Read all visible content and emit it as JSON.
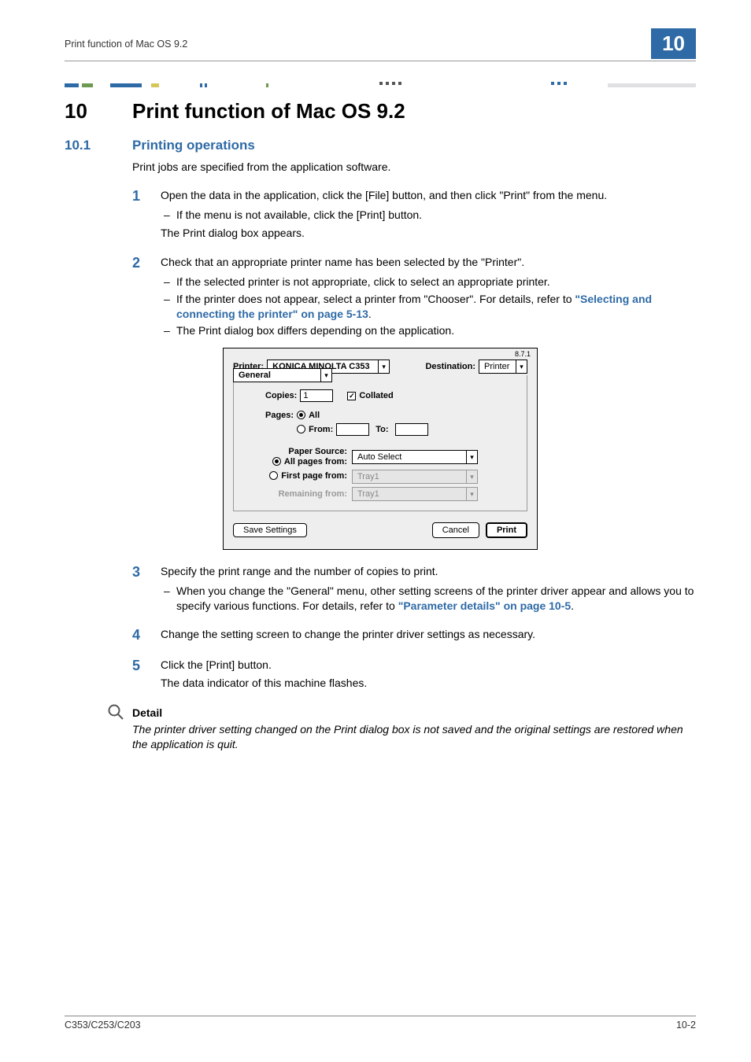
{
  "header": {
    "running_title": "Print function of Mac OS 9.2",
    "chapter_badge": "10"
  },
  "section": {
    "number": "10",
    "title": "Print function of Mac OS 9.2"
  },
  "subsection": {
    "number": "10.1",
    "title": "Printing operations"
  },
  "intro": "Print jobs are specified from the application software.",
  "steps": {
    "s1": {
      "num": "1",
      "text": "Open the data in the application, click the [File] button, and then click \"Print\" from the menu.",
      "bullet1": "If the menu is not available, click the [Print] button.",
      "plain1": "The Print dialog box appears."
    },
    "s2": {
      "num": "2",
      "text": "Check that an appropriate printer name has been selected by the \"Printer\".",
      "bullet1": "If the selected printer is not appropriate, click to select an appropriate printer.",
      "bullet2a": "If the printer does not appear, select a printer from \"Chooser\". For details, refer to ",
      "bullet2_link": "\"Selecting and connecting the printer\" on page 5-13",
      "bullet2b": ".",
      "bullet3": "The Print dialog box differs depending on the application."
    },
    "s3": {
      "num": "3",
      "text": "Specify the print range and the number of copies to print.",
      "bullet1a": "When you change the \"General\" menu, other setting screens of the printer driver appear and allows you to specify various functions. For details, refer to ",
      "bullet1_link": "\"Parameter details\" on page 10-5",
      "bullet1b": "."
    },
    "s4": {
      "num": "4",
      "text": "Change the setting screen to change the printer driver settings as necessary."
    },
    "s5": {
      "num": "5",
      "text": "Click the [Print] button.",
      "plain1": "The data indicator of this machine flashes."
    }
  },
  "dialog": {
    "version": "8.7.1",
    "printer_label": "Printer:",
    "printer_value": "KONICA MINOLTA C353",
    "dest_label": "Destination:",
    "dest_value": "Printer",
    "panel": "General",
    "copies_label": "Copies:",
    "copies_value": "1",
    "collated_label": "Collated",
    "pages_label": "Pages:",
    "pages_all": "All",
    "pages_from": "From:",
    "pages_to": "To:",
    "ps_label": "Paper Source:",
    "ps_all": "All pages from:",
    "ps_all_value": "Auto Select",
    "ps_first": "First page from:",
    "ps_first_value": "Tray1",
    "ps_remaining": "Remaining from:",
    "ps_remaining_value": "Tray1",
    "save_settings": "Save Settings",
    "cancel": "Cancel",
    "print": "Print"
  },
  "detail": {
    "title": "Detail",
    "text": "The printer driver setting changed on the Print dialog box is not saved and the original settings are restored when the application is quit."
  },
  "footer": {
    "left": "C353/C253/C203",
    "right": "10-2"
  }
}
